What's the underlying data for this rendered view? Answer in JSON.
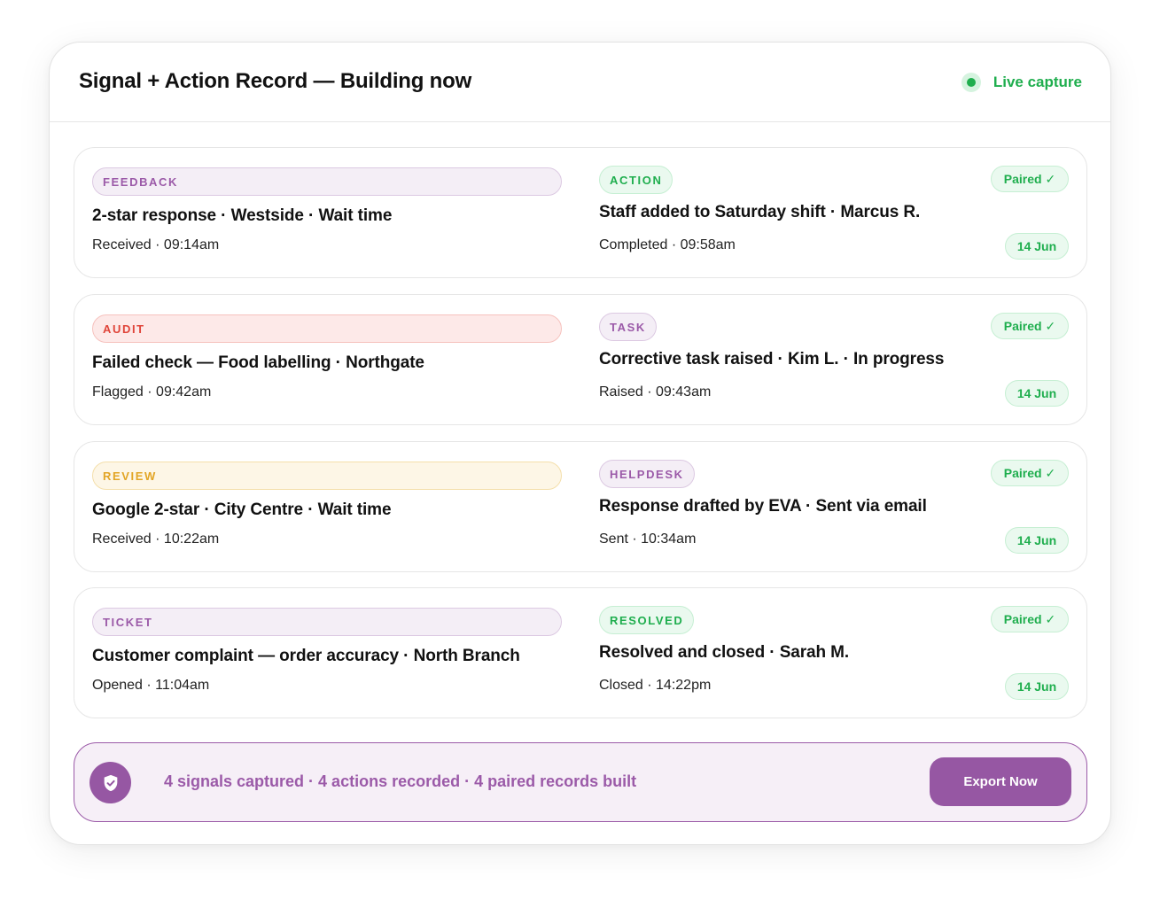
{
  "header": {
    "title": "Signal + Action Record — Building now",
    "live_label": "Live capture"
  },
  "colors": {
    "green": "#1fae4e",
    "purple": "#9b5aa8",
    "red": "#e0453a",
    "amber": "#e2a526"
  },
  "rows": [
    {
      "signal": {
        "tag": "FEEDBACK",
        "tag_color": "purple",
        "title": "2-star response · Westside · Wait time",
        "meta": "Received · 09:14am"
      },
      "action": {
        "tag": "ACTION",
        "tag_color": "green",
        "title": "Staff added to Saturday shift · Marcus R.",
        "meta": "Completed · 09:58am"
      },
      "paired_label": "Paired ✓",
      "date": "14 Jun"
    },
    {
      "signal": {
        "tag": "AUDIT",
        "tag_color": "red",
        "title": "Failed check — Food labelling · Northgate",
        "meta": "Flagged · 09:42am"
      },
      "action": {
        "tag": "TASK",
        "tag_color": "purple",
        "title": "Corrective task raised · Kim L. · In progress",
        "meta": "Raised · 09:43am"
      },
      "paired_label": "Paired ✓",
      "date": "14 Jun"
    },
    {
      "signal": {
        "tag": "REVIEW",
        "tag_color": "amber",
        "title": "Google 2-star · City Centre · Wait time",
        "meta": "Received · 10:22am"
      },
      "action": {
        "tag": "HELPDESK",
        "tag_color": "purple",
        "title": "Response drafted by EVA · Sent via email",
        "meta": "Sent · 10:34am"
      },
      "paired_label": "Paired ✓",
      "date": "14 Jun"
    },
    {
      "signal": {
        "tag": "TICKET",
        "tag_color": "purple",
        "title": "Customer complaint — order accuracy · North Branch",
        "meta": "Opened · 11:04am"
      },
      "action": {
        "tag": "RESOLVED",
        "tag_color": "green",
        "title": "Resolved and closed · Sarah M.",
        "meta": "Closed · 14:22pm"
      },
      "paired_label": "Paired ✓",
      "date": "14 Jun"
    }
  ],
  "footer": {
    "icon": "shield-check-icon",
    "summary": "4 signals captured · 4 actions recorded · 4 paired records built",
    "export_label": "Export Now"
  }
}
